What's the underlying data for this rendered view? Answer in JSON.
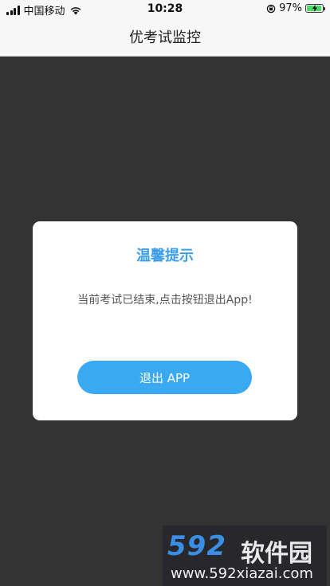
{
  "status_bar": {
    "carrier": "中国移动",
    "time": "10:28",
    "battery_percent": "97%",
    "battery_level": 0.97,
    "icons": [
      "signal-icon",
      "wifi-icon",
      "orientation-lock-icon",
      "battery-charging-icon"
    ]
  },
  "nav": {
    "title": "优考试监控"
  },
  "dialog": {
    "title": "温馨提示",
    "message": "当前考试已结束,点击按钮退出App!",
    "button_label": "退出 APP"
  },
  "watermark": {
    "logo_number": "592",
    "logo_text": "软件园",
    "url": "www.592xiazai.com"
  },
  "colors": {
    "accent": "#3b9eea",
    "button": "#3ba8f2",
    "overlay": "#333333",
    "battery_fill": "#4cd964"
  }
}
